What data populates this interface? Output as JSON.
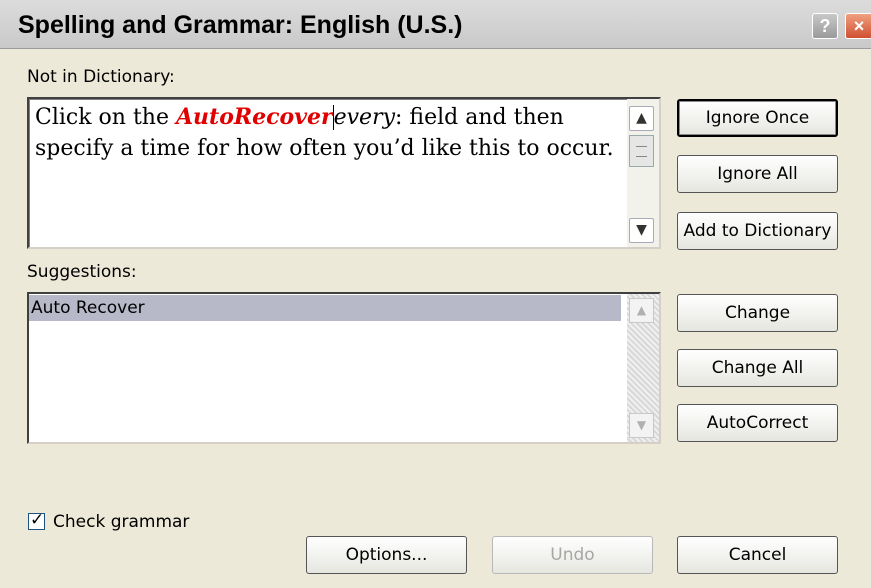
{
  "window": {
    "title": "Spelling and Grammar: English (U.S.)",
    "help_glyph": "?",
    "close_glyph": "×"
  },
  "not_in_dictionary": {
    "label": "Not in Dictionary:",
    "text_before": "Click on the ",
    "error_word": "AutoRecover",
    "text_italic": "every",
    "text_after": ": field and then specify a time for how often you’d like this to occur."
  },
  "suggestions": {
    "label": "Suggestions:",
    "items": [
      "Auto Recover"
    ]
  },
  "buttons": {
    "ignore_once": "Ignore Once",
    "ignore_all": "Ignore All",
    "add_to_dictionary": "Add to Dictionary",
    "change": "Change",
    "change_all": "Change All",
    "autocorrect": "AutoCorrect",
    "options": "Options...",
    "undo": "Undo",
    "cancel": "Cancel"
  },
  "check_grammar": {
    "label": "Check grammar",
    "checked": true,
    "mark": "✓"
  }
}
